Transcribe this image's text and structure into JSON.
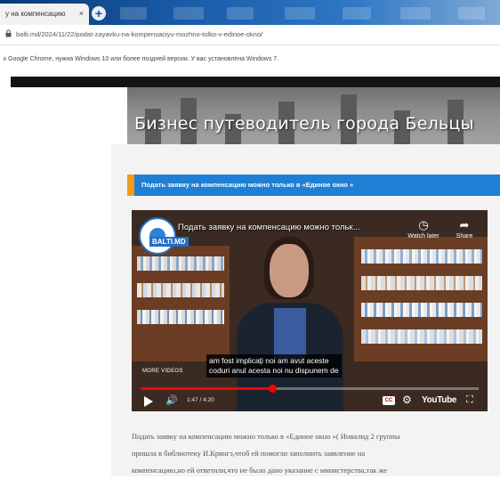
{
  "browser": {
    "tab_title": "у на компенсацию",
    "tab_close": "×",
    "new_tab": "+",
    "url": "balti.md/2024/11/22/podat-zayavku-na-kompensaciyu-mozhno-tolko-v-edinoe-okno/",
    "info_message": "к Google Chrome, нужна Windows 10 или более поздней версии. У вас установлена Windows 7."
  },
  "page": {
    "banner_title": "Бизнес путеводитель города Бельцы",
    "headline": "Подать заявку на компенсацию можно только в «Единое окно »"
  },
  "video": {
    "channel_logo": "BALTI.MD",
    "title": "Подать заявку на компенсацию можно тольк...",
    "watch_later": "Watch later",
    "share": "Share",
    "more_videos": "MORE VIDEOS",
    "subtitle_line1": "am fost implicați noi am avut aceste",
    "subtitle_line2": "coduri anul acesta noi nu dispunem de",
    "time": "1:47 / 4:20",
    "progress": 0.39,
    "youtube_label": "YouTube",
    "cc_label": "CC"
  },
  "article": {
    "line1": "Подать заявку на компенсацию можно только в «Единое окно »( Инвалид 2 группы",
    "line2": "пришла в библиотеку И.Крянгэ,чтоб ей помогли заполнить заявление на",
    "line3": "компенсацию,но ей ответили,что не было дано указание с министерства,так же"
  },
  "colors": {
    "headline_bg": "#1f7fd4",
    "headline_accent": "#f39a1f",
    "progress": "#ff0000"
  }
}
